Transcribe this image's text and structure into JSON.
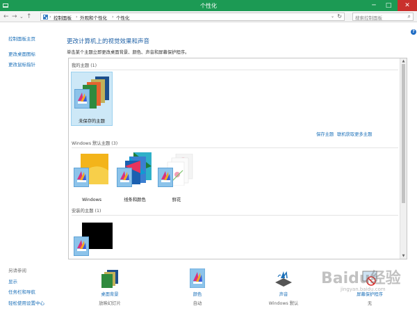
{
  "window": {
    "title": "个性化",
    "minimize": "─",
    "maximize": "□",
    "close": "✕"
  },
  "nav": {
    "back": "←",
    "forward": "→",
    "recent": "⌄",
    "up": "↑"
  },
  "address": {
    "crumbs": [
      "控制面板",
      "外观和个性化",
      "个性化"
    ],
    "separator": "›",
    "dropdown": "⌄",
    "refresh": "↻"
  },
  "search": {
    "placeholder": "搜索控制面板",
    "icon": "⌕"
  },
  "help": "?",
  "sidebar": {
    "home": "控制面板主页",
    "items": [
      "更改桌面图标",
      "更改鼠标指针"
    ]
  },
  "see_also": {
    "heading": "另请参阅",
    "items": [
      "显示",
      "任务栏和导航",
      "轻松使用设置中心"
    ]
  },
  "main": {
    "title": "更改计算机上的视觉效果和声音",
    "description": "单击某个主题立即更改桌面背景、颜色、声音和屏幕保护程序。"
  },
  "sections": {
    "my_themes": {
      "heading": "我的主题 (1)",
      "themes": [
        {
          "label": "未保存的主题"
        }
      ]
    },
    "links": {
      "save": "保存主题",
      "get_more": "联机获取更多主题"
    },
    "windows_themes": {
      "heading": "Windows 默认主题 (3)",
      "themes": [
        {
          "label": "Windows"
        },
        {
          "label": "线条和颜色"
        },
        {
          "label": "鲜花"
        }
      ]
    },
    "installed_themes": {
      "heading": "安装的主题 (1)"
    }
  },
  "bottom": [
    {
      "label": "桌面背景",
      "sub": "放映幻灯片"
    },
    {
      "label": "颜色",
      "sub": "自动"
    },
    {
      "label": "声音",
      "sub": "Windows 默认"
    },
    {
      "label": "屏幕保护程序",
      "sub": "无"
    }
  ],
  "watermark": {
    "text": "Baidu经验",
    "sub": "jingyan.baidu.com"
  },
  "colors": {
    "titlebar": "#1c9a54",
    "link": "#1a6fb8",
    "title": "#1c5fa5",
    "selected": "#cde8f7"
  }
}
